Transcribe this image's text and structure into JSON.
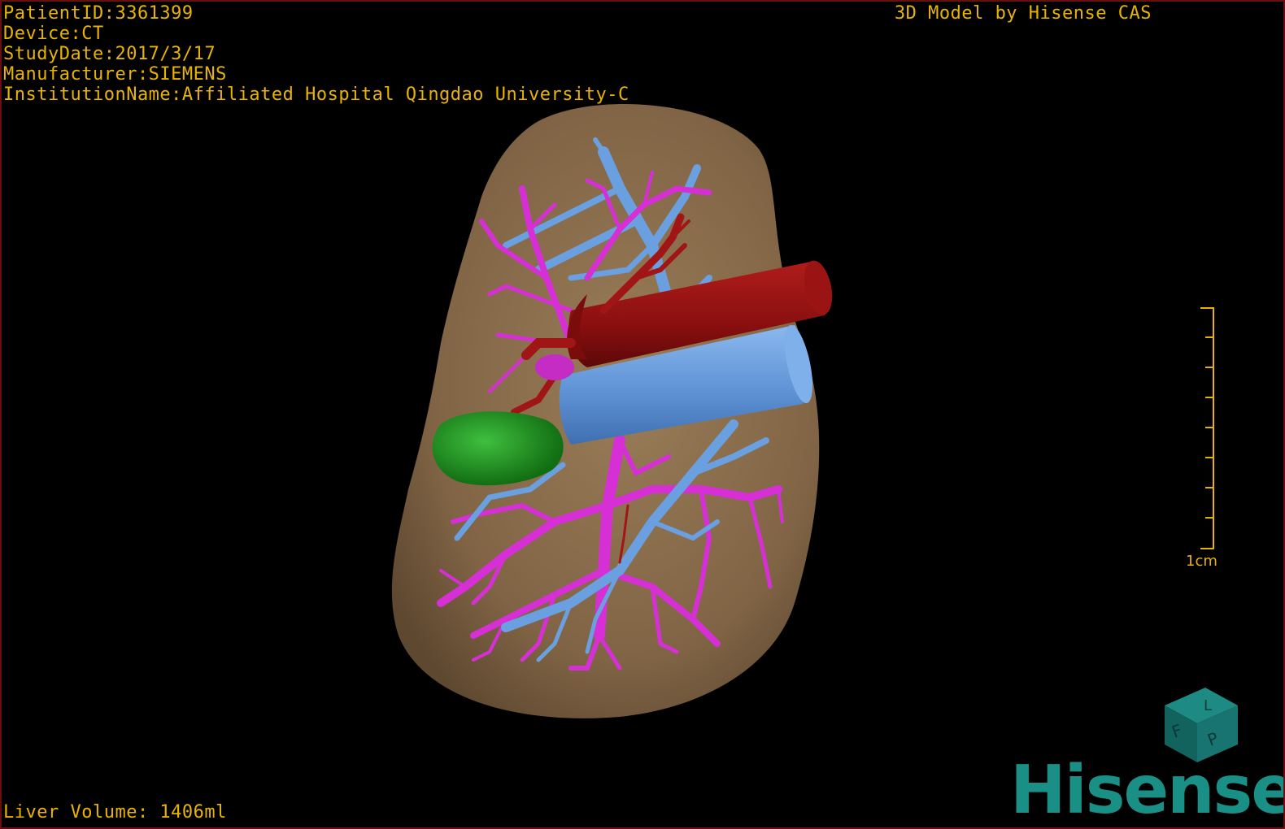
{
  "patient_info": {
    "patient_id": "PatientID:3361399",
    "device": "Device:CT",
    "study_date": "StudyDate:2017/3/17",
    "manufacturer": "Manufacturer:SIEMENS",
    "institution": "InstitutionName:Affiliated Hospital Qingdao University-C"
  },
  "credit": "3D Model by Hisense CAS",
  "liver_volume": "Liver Volume: 1406ml",
  "scale_bar": {
    "label": "1cm"
  },
  "brand": {
    "logo_text": "Hisense"
  },
  "orientation_cube": {
    "face_labels": [
      "F",
      "L",
      "P"
    ]
  },
  "colors": {
    "overlay_text": "#e8b400",
    "liver": "#8a6d4c",
    "artery": "#8e0f0f",
    "portal_vein": "#d62fd6",
    "hepatic_vein": "#6a9fe0",
    "lesion": "#1f9a1f",
    "brand": "#1a8f86"
  }
}
